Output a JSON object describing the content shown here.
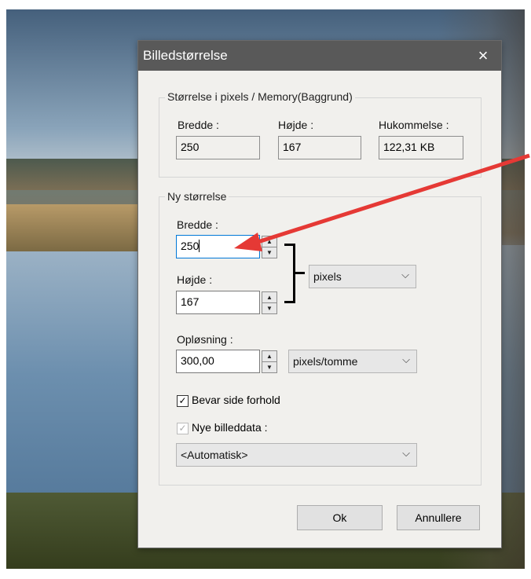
{
  "dialog": {
    "title": "Billedstørrelse",
    "close_icon": "×",
    "current": {
      "legend": "Størrelse i pixels / Memory(Baggrund)",
      "width_label": "Bredde :",
      "width_value": "250",
      "height_label": "Højde :",
      "height_value": "167",
      "memory_label": "Hukommelse :",
      "memory_value": "122,31 KB"
    },
    "new_size": {
      "legend": "Ny størrelse",
      "width_label": "Bredde :",
      "width_value": "250",
      "height_label": "Højde :",
      "height_value": "167",
      "unit_selected": "pixels",
      "resolution_label": "Opløsning :",
      "resolution_value": "300,00",
      "resolution_unit_selected": "pixels/tomme",
      "keep_ratio_label": "Bevar side forhold",
      "keep_ratio_checked": true,
      "new_data_label": "Nye billeddata :",
      "new_data_checked": true,
      "new_data_selected": "<Automatisk>"
    },
    "ok_label": "Ok",
    "cancel_label": "Annullere"
  },
  "annotation": {
    "arrow_color": "#e53935",
    "bracket_color": "#000000"
  }
}
